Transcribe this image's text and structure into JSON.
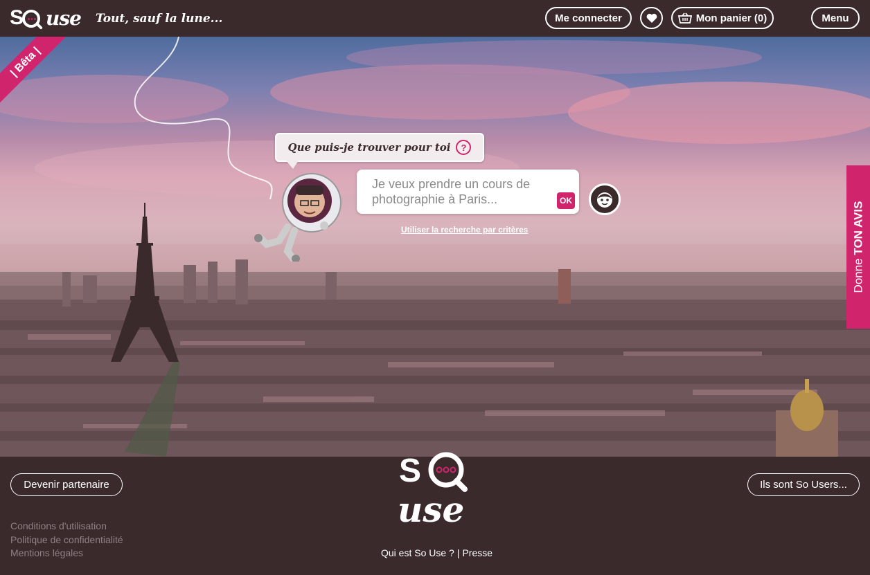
{
  "header": {
    "logo_so": "SO",
    "logo_use": "use",
    "tagline": "Tout, sauf la lune...",
    "login_label": "Me connecter",
    "cart_label": "Mon panier (0)",
    "menu_label": "Menu"
  },
  "hero": {
    "beta_label": "| Bêta |",
    "question": "Que puis-je trouver pour toi",
    "question_icon": "?",
    "search_placeholder": "Je veux prendre un cours de photographie à Paris...",
    "ok_label": "OK",
    "criteria_link": "Utiliser la recherche par critères",
    "feedback_prefix": "Donne ",
    "feedback_strong": "TON AVIS"
  },
  "footer": {
    "partner_label": "Devenir partenaire",
    "users_label": "Ils sont So Users...",
    "legal_links": [
      "Conditions d'utilisation",
      "Politique de confidentialité",
      "Mentions légales"
    ],
    "about_link": "Qui est So Use ?",
    "separator": "|",
    "press_link": "Presse"
  },
  "colors": {
    "brand_dark": "#3b2a2c",
    "brand_pink": "#d0246c"
  }
}
